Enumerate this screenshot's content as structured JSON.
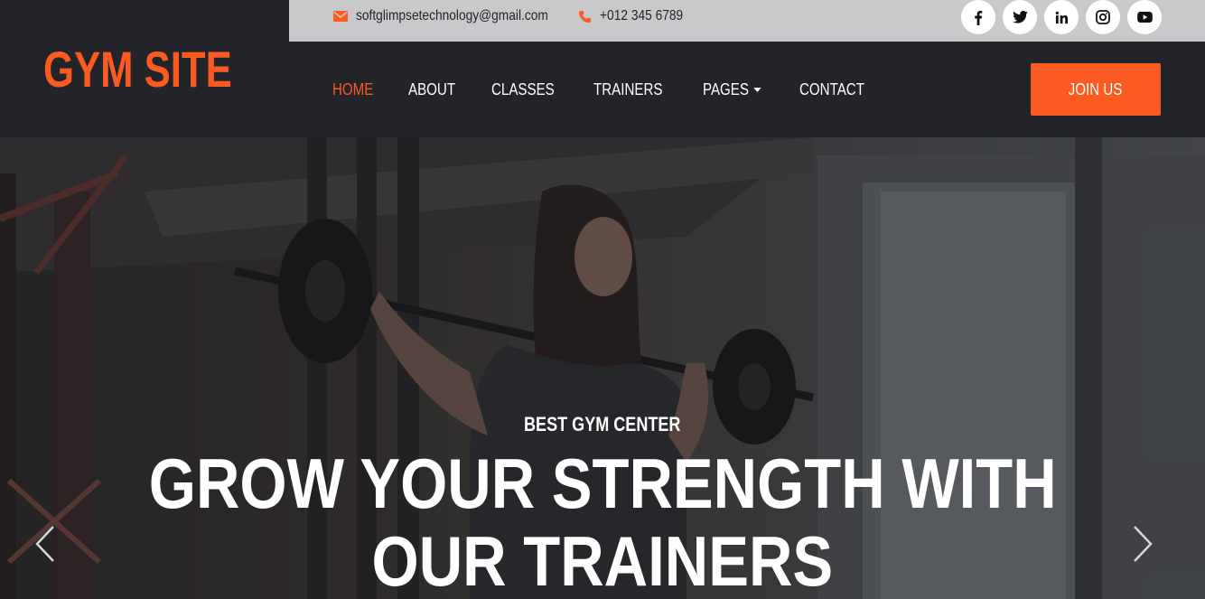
{
  "brand": {
    "title": "GYM SITE",
    "color": "#fb5b21"
  },
  "topbar": {
    "email": {
      "icon": "envelope-icon",
      "text": "softglimpsetechnology@gmail.com"
    },
    "phone": {
      "icon": "phone-icon",
      "text": "+012 345 6789"
    },
    "socials": [
      {
        "name": "facebook-icon"
      },
      {
        "name": "twitter-icon"
      },
      {
        "name": "linkedin-icon"
      },
      {
        "name": "instagram-icon"
      },
      {
        "name": "youtube-icon"
      }
    ]
  },
  "nav": {
    "items": [
      {
        "label": "HOME",
        "active": true
      },
      {
        "label": "ABOUT"
      },
      {
        "label": "CLASSES"
      },
      {
        "label": "TRAINERS"
      },
      {
        "label": "PAGES",
        "dropdown": true
      },
      {
        "label": "CONTACT"
      }
    ],
    "cta": "JOIN US"
  },
  "hero": {
    "subtitle": "BEST GYM CENTER",
    "title_line1": "GROW YOUR STRENGTH WITH",
    "title_line2": "OUR TRAINERS"
  },
  "colors": {
    "accent": "#fb5b21",
    "dark": "#23232a",
    "topbar": "#c9c9cb"
  }
}
